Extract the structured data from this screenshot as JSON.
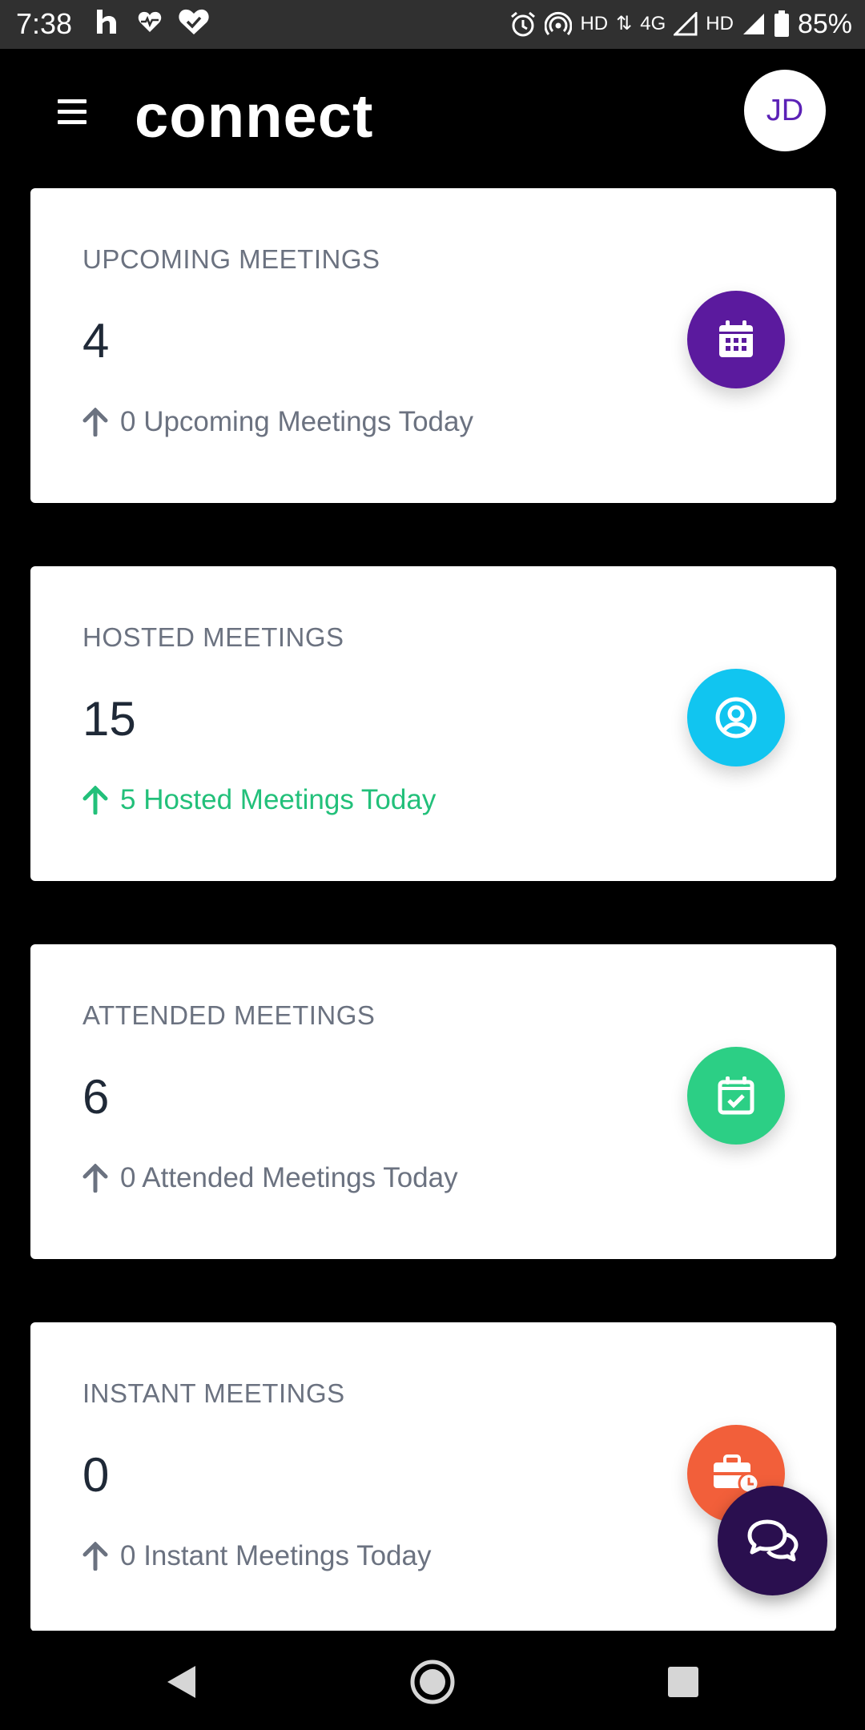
{
  "status_bar": {
    "time": "7:38",
    "hd1": "HD",
    "network": "4G",
    "hd2": "HD",
    "battery": "85%"
  },
  "header": {
    "logo_text": "connect",
    "avatar_initials": "JD"
  },
  "cards": [
    {
      "title": "UPCOMING MEETINGS",
      "value": "4",
      "subtitle": "0 Upcoming Meetings Today",
      "icon": "calendar-grid-icon",
      "color": "#5b1a9e"
    },
    {
      "title": "HOSTED MEETINGS",
      "value": "15",
      "subtitle": "5 Hosted Meetings Today",
      "icon": "user-circle-icon",
      "color": "#11c5f0"
    },
    {
      "title": "ATTENDED MEETINGS",
      "value": "6",
      "subtitle": "0 Attended Meetings Today",
      "icon": "calendar-check-icon",
      "color": "#2ccf85"
    },
    {
      "title": "INSTANT MEETINGS",
      "value": "0",
      "subtitle": "0 Instant Meetings Today",
      "icon": "briefcase-clock-icon",
      "color": "#f25f3a"
    }
  ],
  "colors": {
    "positive": "#22c07a",
    "muted": "#6b7280",
    "chat_fab": "#2a0f4f"
  }
}
